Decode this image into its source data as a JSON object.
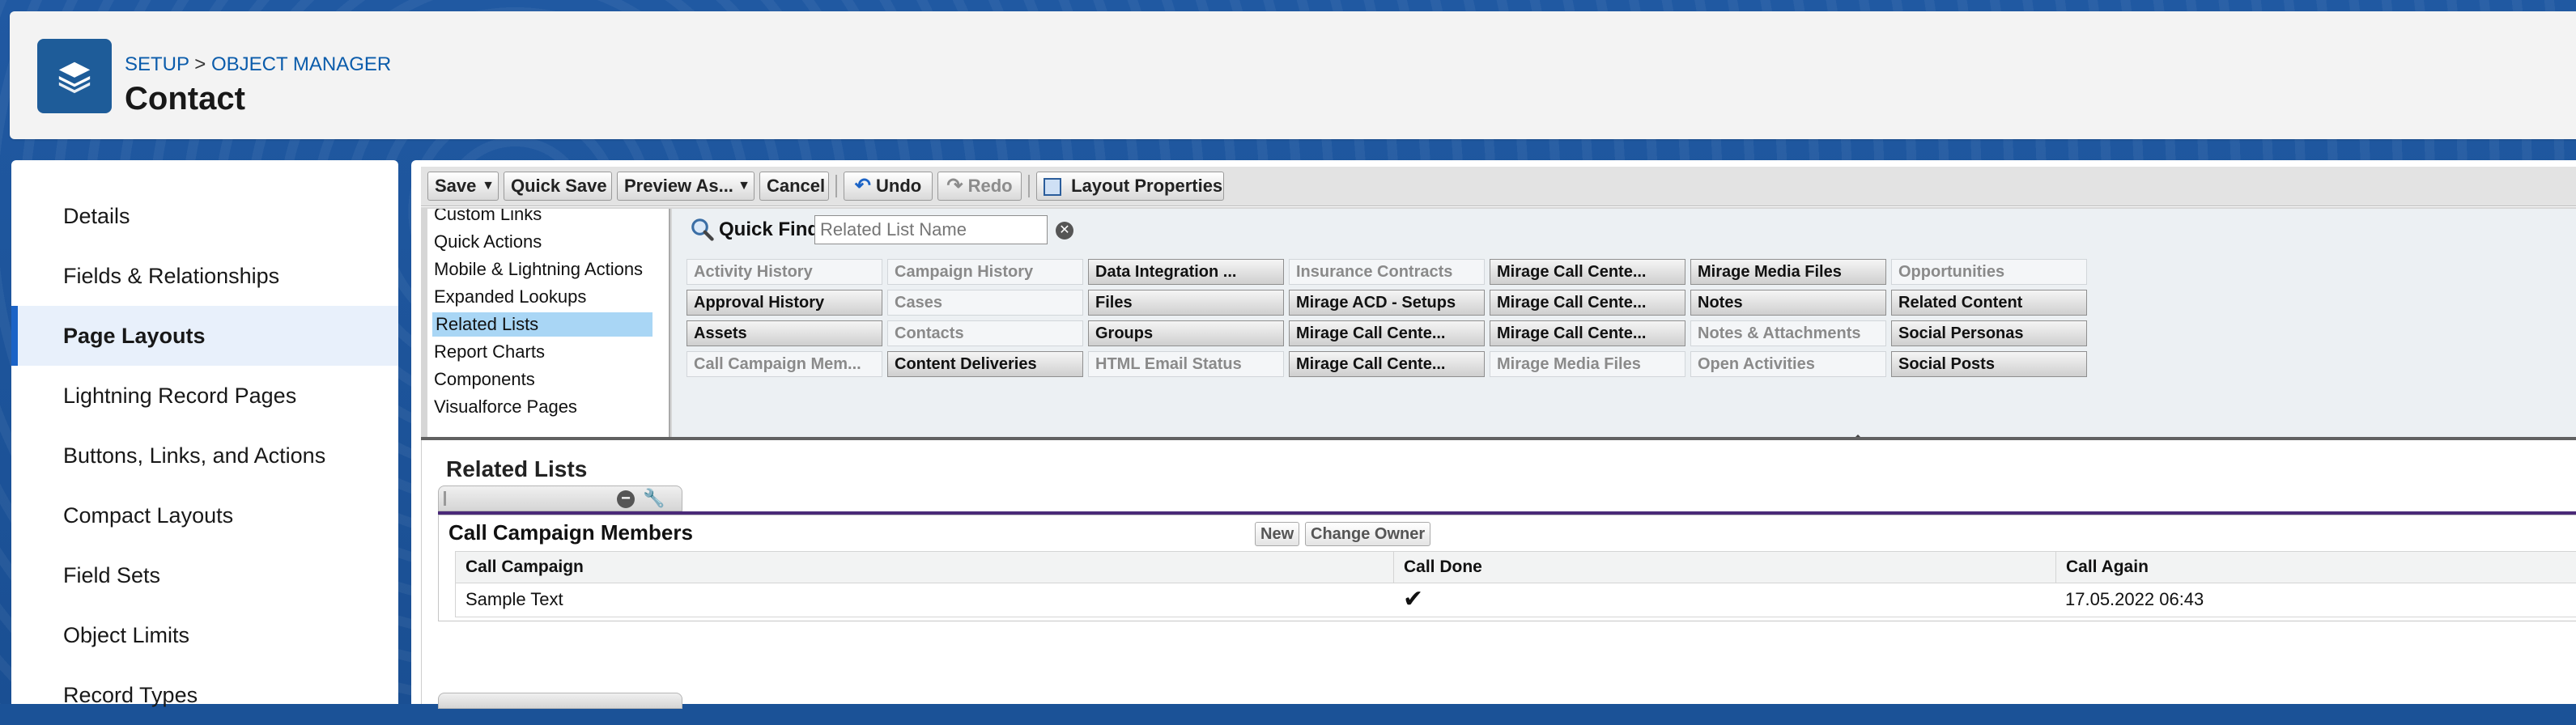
{
  "header": {
    "breadcrumb": [
      "SETUP",
      "OBJECT MANAGER"
    ],
    "breadcrumb_sep": ">",
    "title": "Contact",
    "icon": "layers-icon"
  },
  "sidebar": {
    "items": [
      {
        "label": "Details"
      },
      {
        "label": "Fields & Relationships"
      },
      {
        "label": "Page Layouts",
        "active": true
      },
      {
        "label": "Lightning Record Pages"
      },
      {
        "label": "Buttons, Links, and Actions"
      },
      {
        "label": "Compact Layouts"
      },
      {
        "label": "Field Sets"
      },
      {
        "label": "Object Limits"
      },
      {
        "label": "Record Types"
      }
    ]
  },
  "toolbar": {
    "save": "Save",
    "quick_save": "Quick Save",
    "preview_as": "Preview As...",
    "cancel": "Cancel",
    "undo": "Undo",
    "redo": "Redo",
    "layout_properties": "Layout Properties"
  },
  "palette": {
    "categories": [
      "Custom Links",
      "Quick Actions",
      "Mobile & Lightning Actions",
      "Expanded Lookups",
      "Related Lists",
      "Report Charts",
      "Components",
      "Visualforce Pages"
    ],
    "selected_category": "Related Lists",
    "quick_find_label": "Quick Find",
    "quick_find_placeholder": "Related List Name",
    "columns": [
      [
        {
          "label": "Activity History",
          "used": true
        },
        {
          "label": "Approval History",
          "used": false
        },
        {
          "label": "Assets",
          "used": false
        },
        {
          "label": "Call Campaign Mem...",
          "used": true
        }
      ],
      [
        {
          "label": "Campaign History",
          "used": true
        },
        {
          "label": "Cases",
          "used": true
        },
        {
          "label": "Contacts",
          "used": true
        },
        {
          "label": "Content Deliveries",
          "used": false
        }
      ],
      [
        {
          "label": "Data Integration ...",
          "used": false
        },
        {
          "label": "Files",
          "used": false
        },
        {
          "label": "Groups",
          "used": false
        },
        {
          "label": "HTML Email Status",
          "used": true
        }
      ],
      [
        {
          "label": "Insurance Contracts",
          "used": true
        },
        {
          "label": "Mirage ACD - Setups",
          "used": false
        },
        {
          "label": "Mirage Call Cente...",
          "used": false
        },
        {
          "label": "Mirage Call Cente...",
          "used": false
        }
      ],
      [
        {
          "label": "Mirage Call Cente...",
          "used": false
        },
        {
          "label": "Mirage Call Cente...",
          "used": false
        },
        {
          "label": "Mirage Call Cente...",
          "used": false
        },
        {
          "label": "Mirage Media Files",
          "used": true
        }
      ],
      [
        {
          "label": "Mirage Media Files",
          "used": false
        },
        {
          "label": "Notes",
          "used": false
        },
        {
          "label": "Notes & Attachments",
          "used": true
        },
        {
          "label": "Open Activities",
          "used": true
        }
      ],
      [
        {
          "label": "Opportunities",
          "used": true
        },
        {
          "label": "Related Content",
          "used": false
        },
        {
          "label": "Social Personas",
          "used": false
        },
        {
          "label": "Social Posts",
          "used": false
        }
      ]
    ]
  },
  "layout": {
    "section_title": "Related Lists",
    "related_list": {
      "title": "Call Campaign Members",
      "buttons": [
        "New",
        "Change Owner"
      ],
      "columns": [
        "Call Campaign",
        "Call Done",
        "Call Again"
      ],
      "row": {
        "call_campaign": "Sample Text",
        "call_done": "✔",
        "call_again": "17.05.2022 06:43"
      }
    }
  }
}
